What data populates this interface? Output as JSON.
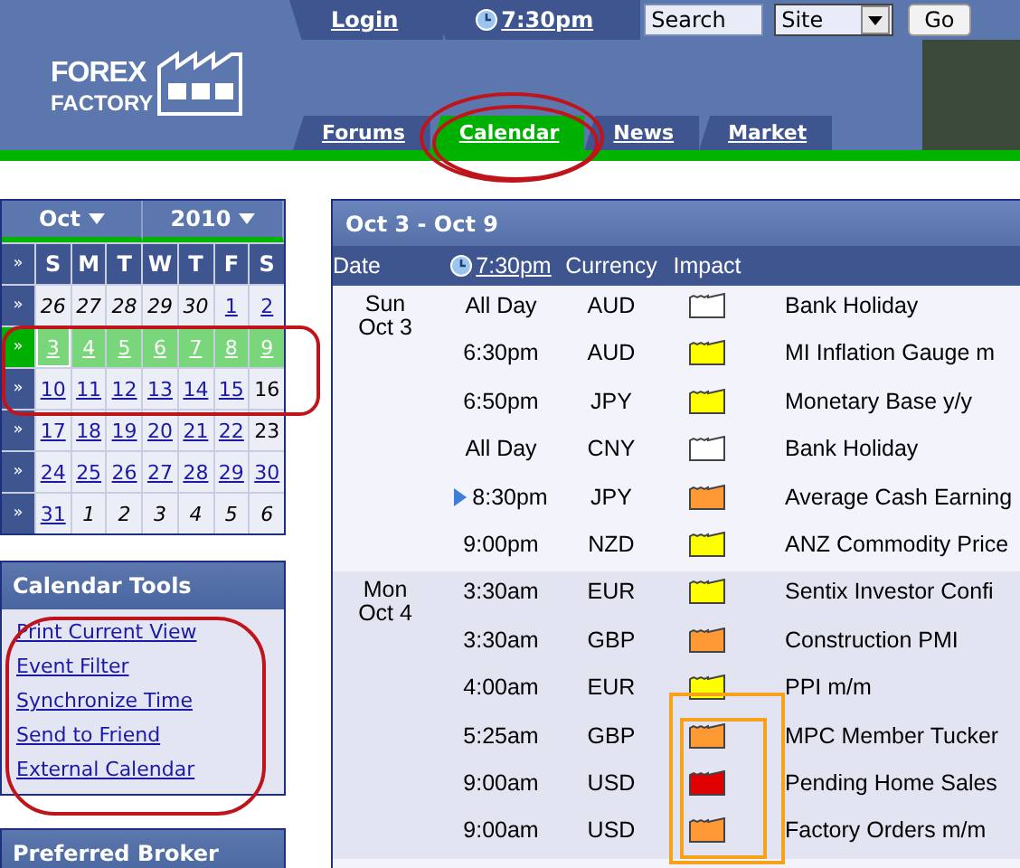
{
  "top_bar": {
    "login": "Login",
    "time": "7:30pm",
    "search": {
      "value": "Search"
    },
    "scope_select": {
      "value": "Site"
    },
    "go_button": "Go"
  },
  "logo": {
    "line1": "FOREX",
    "line2": "FACTORY"
  },
  "nav_tabs": [
    {
      "label": "Forums",
      "selected": false
    },
    {
      "label": "Calendar",
      "selected": true
    },
    {
      "label": "News",
      "selected": false
    },
    {
      "label": "Market",
      "selected": false
    }
  ],
  "mini_calendar": {
    "month": "Oct",
    "year": "2010",
    "weekday_headers": [
      "S",
      "M",
      "T",
      "W",
      "T",
      "F",
      "S"
    ],
    "week_button": "»",
    "weeks": [
      {
        "selected": false,
        "days": [
          {
            "label": "26",
            "kind": "other"
          },
          {
            "label": "27",
            "kind": "other"
          },
          {
            "label": "28",
            "kind": "other"
          },
          {
            "label": "29",
            "kind": "other"
          },
          {
            "label": "30",
            "kind": "other"
          },
          {
            "label": "1",
            "kind": "link"
          },
          {
            "label": "2",
            "kind": "link"
          }
        ]
      },
      {
        "selected": true,
        "days": [
          {
            "label": "3",
            "kind": "today"
          },
          {
            "label": "4",
            "kind": "link"
          },
          {
            "label": "5",
            "kind": "link"
          },
          {
            "label": "6",
            "kind": "link"
          },
          {
            "label": "7",
            "kind": "link"
          },
          {
            "label": "8",
            "kind": "link"
          },
          {
            "label": "9",
            "kind": "link"
          }
        ]
      },
      {
        "selected": false,
        "days": [
          {
            "label": "10",
            "kind": "link"
          },
          {
            "label": "11",
            "kind": "link"
          },
          {
            "label": "12",
            "kind": "link"
          },
          {
            "label": "13",
            "kind": "link"
          },
          {
            "label": "14",
            "kind": "link"
          },
          {
            "label": "15",
            "kind": "link"
          },
          {
            "label": "16",
            "kind": "plain"
          }
        ]
      },
      {
        "selected": false,
        "days": [
          {
            "label": "17",
            "kind": "link"
          },
          {
            "label": "18",
            "kind": "link"
          },
          {
            "label": "19",
            "kind": "link"
          },
          {
            "label": "20",
            "kind": "link"
          },
          {
            "label": "21",
            "kind": "link"
          },
          {
            "label": "22",
            "kind": "link"
          },
          {
            "label": "23",
            "kind": "plain"
          }
        ]
      },
      {
        "selected": false,
        "days": [
          {
            "label": "24",
            "kind": "link"
          },
          {
            "label": "25",
            "kind": "link"
          },
          {
            "label": "26",
            "kind": "link"
          },
          {
            "label": "27",
            "kind": "link"
          },
          {
            "label": "28",
            "kind": "link"
          },
          {
            "label": "29",
            "kind": "link"
          },
          {
            "label": "30",
            "kind": "link"
          }
        ]
      },
      {
        "selected": false,
        "days": [
          {
            "label": "31",
            "kind": "link"
          },
          {
            "label": "1",
            "kind": "other"
          },
          {
            "label": "2",
            "kind": "other"
          },
          {
            "label": "3",
            "kind": "other"
          },
          {
            "label": "4",
            "kind": "other"
          },
          {
            "label": "5",
            "kind": "other"
          },
          {
            "label": "6",
            "kind": "other"
          }
        ]
      }
    ]
  },
  "calendar_tools": {
    "title": "Calendar Tools",
    "links": [
      "Print Current View",
      "Event Filter",
      "Synchronize Time",
      "Send to Friend",
      "External Calendar"
    ]
  },
  "preferred_broker": {
    "title": "Preferred Broker"
  },
  "events_panel": {
    "title": "Oct 3 - Oct 9",
    "columns": {
      "date": "Date",
      "time": "7:30pm",
      "currency": "Currency",
      "impact": "Impact"
    },
    "days": [
      {
        "weekday": "Sun",
        "date": "Oct 3",
        "events": [
          {
            "time": "All Day",
            "currency": "AUD",
            "kind": "holiday",
            "current": false,
            "event": "Bank Holiday"
          },
          {
            "time": "6:30pm",
            "currency": "AUD",
            "kind": "low",
            "current": false,
            "event": "MI Inflation Gauge m"
          },
          {
            "time": "6:50pm",
            "currency": "JPY",
            "kind": "low",
            "current": false,
            "event": "Monetary Base y/y"
          },
          {
            "time": "All Day",
            "currency": "CNY",
            "kind": "holiday",
            "current": false,
            "event": "Bank Holiday"
          },
          {
            "time": "8:30pm",
            "currency": "JPY",
            "kind": "medium",
            "current": true,
            "event": "Average Cash Earning"
          },
          {
            "time": "9:00pm",
            "currency": "NZD",
            "kind": "low",
            "current": false,
            "event": "ANZ Commodity Price"
          }
        ]
      },
      {
        "weekday": "Mon",
        "date": "Oct 4",
        "events": [
          {
            "time": "3:30am",
            "currency": "EUR",
            "kind": "low",
            "current": false,
            "event": "Sentix Investor Confi"
          },
          {
            "time": "3:30am",
            "currency": "GBP",
            "kind": "medium",
            "current": false,
            "event": "Construction PMI"
          },
          {
            "time": "4:00am",
            "currency": "EUR",
            "kind": "low",
            "current": false,
            "event": "PPI m/m"
          },
          {
            "time": "5:25am",
            "currency": "GBP",
            "kind": "medium",
            "current": false,
            "event": "MPC Member Tucker"
          },
          {
            "time": "9:00am",
            "currency": "USD",
            "kind": "high",
            "current": false,
            "event": "Pending Home Sales"
          },
          {
            "time": "9:00am",
            "currency": "USD",
            "kind": "medium",
            "current": false,
            "event": "Factory Orders m/m"
          }
        ]
      }
    ]
  }
}
